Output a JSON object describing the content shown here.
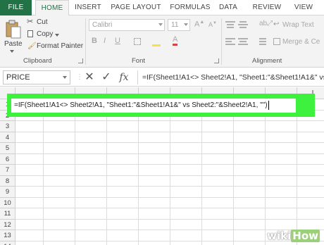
{
  "ribbon_tabs": [
    "FILE",
    "HOME",
    "INSERT",
    "PAGE LAYOUT",
    "FORMULAS",
    "DATA",
    "REVIEW",
    "VIEW"
  ],
  "clipboard": {
    "paste": "Paste",
    "cut": "Cut",
    "copy": "Copy",
    "format_painter": "Format Painter",
    "group_label": "Clipboard"
  },
  "font": {
    "font_name": "Calibri",
    "font_size": "11",
    "bold": "B",
    "italic": "I",
    "underline": "U",
    "group_label": "Font"
  },
  "alignment": {
    "wrap_text": "Wrap Text",
    "merge_center": "Merge & Ce",
    "group_label": "Alignment"
  },
  "formula_bar": {
    "name_box": "PRICE",
    "cancel": "✕",
    "enter": "✓",
    "fx": "fx",
    "formula": "=IF(Sheet1!A1<> Sheet2!A1, \"Sheet1:\"&Sheet1!A1&\" vs Sheet2:\"&Sheet2!A1, \"\")"
  },
  "grid": {
    "column_labels": [
      "",
      "",
      "",
      "",
      "",
      "",
      "",
      "",
      "",
      "I",
      ""
    ],
    "row_labels": [
      "1",
      "2",
      "3",
      "4",
      "5",
      "6",
      "7",
      "8",
      "9",
      "10",
      "11",
      "12",
      "13",
      "14"
    ]
  },
  "active_cell_formula": "=IF(Sheet1!A1<> Sheet2!A1, \"Sheet1:\"&Sheet1!A1&\" vs Sheet2:\"&Sheet2!A1, \"\")",
  "watermark": {
    "wiki": "wiki",
    "how": "How"
  },
  "colors": {
    "excel_green": "#217346",
    "highlight_green": "#3ff13f"
  }
}
